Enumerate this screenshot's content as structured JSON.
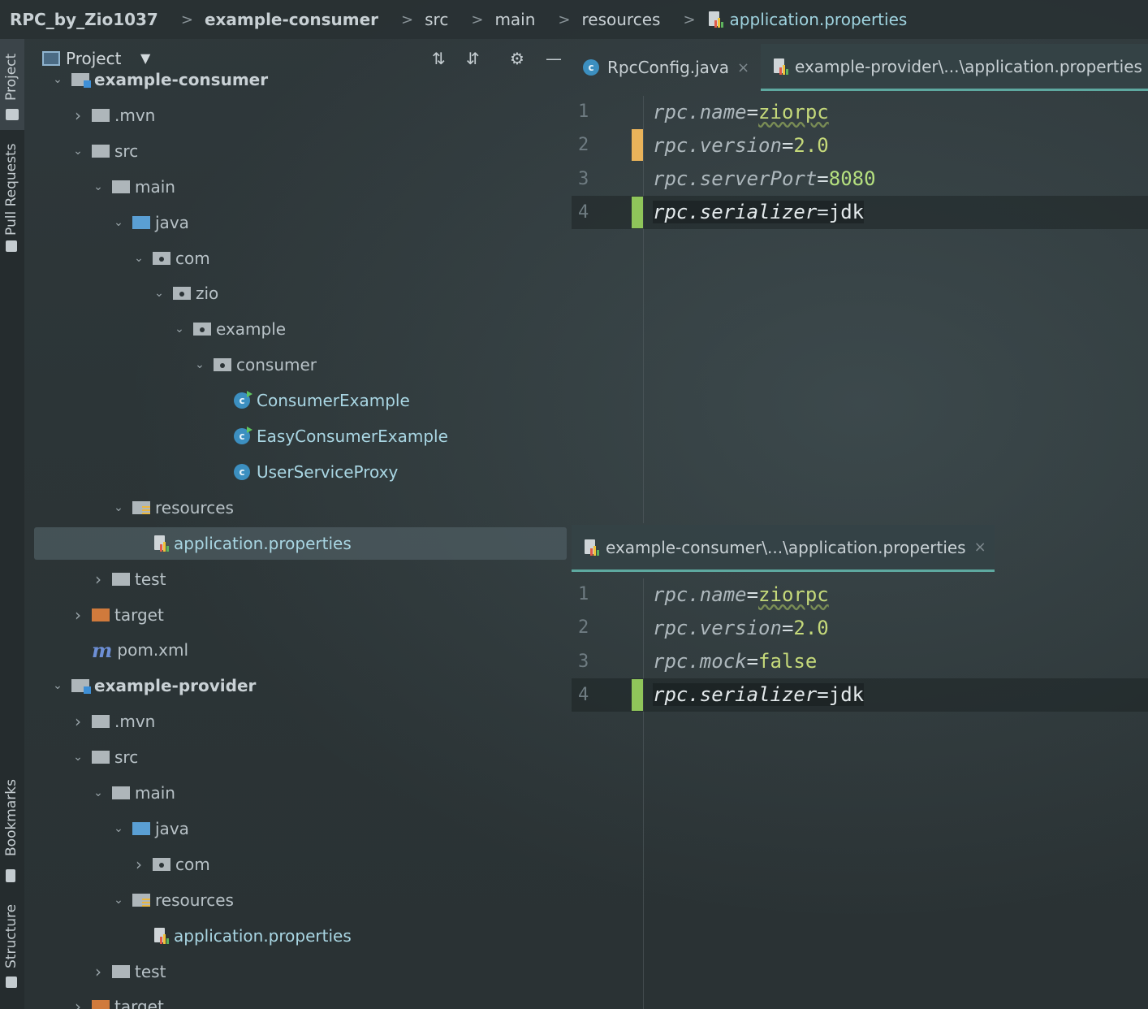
{
  "breadcrumb": {
    "project": "RPC_by_Zio1037",
    "module": "example-consumer",
    "src": "src",
    "main": "main",
    "resources": "resources",
    "file": "application.properties"
  },
  "tool_strip": {
    "project": "Project",
    "pull_requests": "Pull Requests",
    "bookmarks": "Bookmarks",
    "structure": "Structure"
  },
  "project_panel": {
    "title": "Project",
    "tree": [
      {
        "label": "example-consumer",
        "kind": "module",
        "depth": 1,
        "expanded": true
      },
      {
        "label": ".mvn",
        "kind": "folder",
        "depth": 2,
        "expanded": false
      },
      {
        "label": "src",
        "kind": "folder",
        "depth": 2,
        "expanded": true
      },
      {
        "label": "main",
        "kind": "folder",
        "depth": 3,
        "expanded": true
      },
      {
        "label": "java",
        "kind": "source",
        "depth": 4,
        "expanded": true
      },
      {
        "label": "com",
        "kind": "package",
        "depth": 5,
        "expanded": true
      },
      {
        "label": "zio",
        "kind": "package",
        "depth": 6,
        "expanded": true
      },
      {
        "label": "example",
        "kind": "package",
        "depth": 7,
        "expanded": true
      },
      {
        "label": "consumer",
        "kind": "package",
        "depth": 8,
        "expanded": true
      },
      {
        "label": "ConsumerExample",
        "kind": "class-run",
        "depth": 9
      },
      {
        "label": "EasyConsumerExample",
        "kind": "class-run",
        "depth": 9
      },
      {
        "label": "UserServiceProxy",
        "kind": "class",
        "depth": 9
      },
      {
        "label": "resources",
        "kind": "resources",
        "depth": 4,
        "expanded": true
      },
      {
        "label": "application.properties",
        "kind": "properties",
        "depth": 5,
        "selected": true
      },
      {
        "label": "test",
        "kind": "folder",
        "depth": 3,
        "expanded": false
      },
      {
        "label": "target",
        "kind": "target",
        "depth": 2,
        "expanded": false
      },
      {
        "label": "pom.xml",
        "kind": "maven",
        "depth": 2
      },
      {
        "label": "example-provider",
        "kind": "module",
        "depth": 1,
        "expanded": true
      },
      {
        "label": ".mvn",
        "kind": "folder",
        "depth": 2,
        "expanded": false
      },
      {
        "label": "src",
        "kind": "folder",
        "depth": 2,
        "expanded": true
      },
      {
        "label": "main",
        "kind": "folder",
        "depth": 3,
        "expanded": true
      },
      {
        "label": "java",
        "kind": "source",
        "depth": 4,
        "expanded": true
      },
      {
        "label": "com",
        "kind": "package",
        "depth": 5,
        "expanded": false
      },
      {
        "label": "resources",
        "kind": "resources",
        "depth": 4,
        "expanded": true
      },
      {
        "label": "application.properties",
        "kind": "properties",
        "depth": 5
      },
      {
        "label": "test",
        "kind": "folder",
        "depth": 3,
        "expanded": false
      },
      {
        "label": "target",
        "kind": "target",
        "depth": 2,
        "expanded": false
      }
    ]
  },
  "editor_top": {
    "tabs": [
      {
        "label": "RpcConfig.java",
        "icon": "java-class-icon",
        "active": false
      },
      {
        "label": "example-provider\\...\\application.properties",
        "icon": "properties-file-icon",
        "active": true
      }
    ],
    "lines": [
      {
        "n": "1",
        "key": "rpc.name",
        "value": "ziorpc",
        "change": "",
        "wavy": true
      },
      {
        "n": "2",
        "key": "rpc.version",
        "value": "2.0",
        "change": "modified"
      },
      {
        "n": "3",
        "key": "rpc.serverPort",
        "value": "8080",
        "change": ""
      },
      {
        "n": "4",
        "key": "rpc.serializer",
        "value": "jdk",
        "change": "added",
        "current": true
      }
    ]
  },
  "editor_bottom": {
    "tabs": [
      {
        "label": "example-consumer\\...\\application.properties",
        "icon": "properties-file-icon",
        "active": true
      }
    ],
    "lines": [
      {
        "n": "1",
        "key": "rpc.name",
        "value": "ziorpc",
        "change": "",
        "wavy": true
      },
      {
        "n": "2",
        "key": "rpc.version",
        "value": "2.0",
        "change": ""
      },
      {
        "n": "3",
        "key": "rpc.mock",
        "value": "false",
        "change": ""
      },
      {
        "n": "4",
        "key": "rpc.serializer",
        "value": "jdk",
        "change": "added",
        "current": true
      }
    ]
  }
}
